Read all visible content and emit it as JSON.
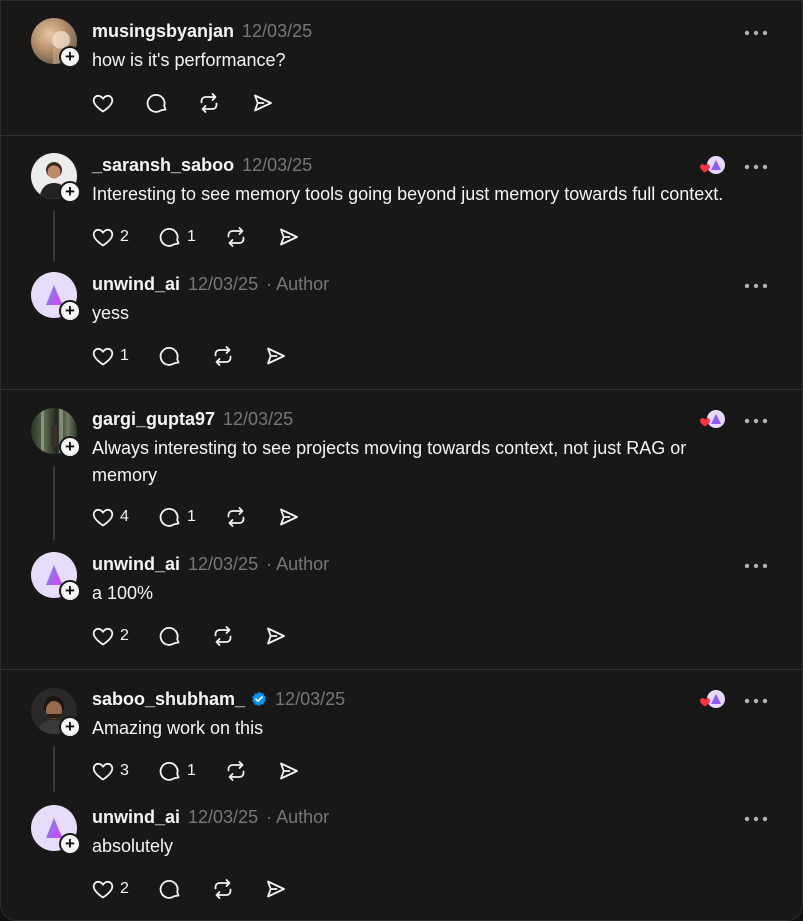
{
  "posts": [
    {
      "username": "musingsbyanjan",
      "time": "12/03/25",
      "text": "how is it's performance?",
      "likes": "",
      "replies": ""
    },
    {
      "username": "_saransh_saboo",
      "time": "12/03/25",
      "text": "Interesting to see memory tools going beyond just memory towards full context.",
      "likes": "2",
      "replies": "1"
    },
    {
      "username": "unwind_ai",
      "time": "12/03/25",
      "author": "· Author",
      "text": "yess",
      "likes": "1",
      "replies": ""
    },
    {
      "username": "gargi_gupta97",
      "time": "12/03/25",
      "text": "Always interesting to see projects moving towards context, not just RAG or memory",
      "likes": "4",
      "replies": "1"
    },
    {
      "username": "unwind_ai",
      "time": "12/03/25",
      "author": "· Author",
      "text": "a 100%",
      "likes": "2",
      "replies": ""
    },
    {
      "username": "saboo_shubham_",
      "time": "12/03/25",
      "text": "Amazing work on this",
      "likes": "3",
      "replies": "1"
    },
    {
      "username": "unwind_ai",
      "time": "12/03/25",
      "author": "· Author",
      "text": "absolutely",
      "likes": "2",
      "replies": ""
    }
  ],
  "icons": {
    "like": "heart-icon",
    "reply": "comment-icon",
    "repost": "repost-icon",
    "share": "send-icon",
    "more": "more-options-icon",
    "follow": "plus-icon",
    "verified": "verified-badge-icon"
  },
  "colors": {
    "background": "#181818",
    "text": "#f3f5f7",
    "muted": "#777777",
    "verified": "#0095f6",
    "liked": "#ff3040",
    "brand": "#b48bf5"
  }
}
